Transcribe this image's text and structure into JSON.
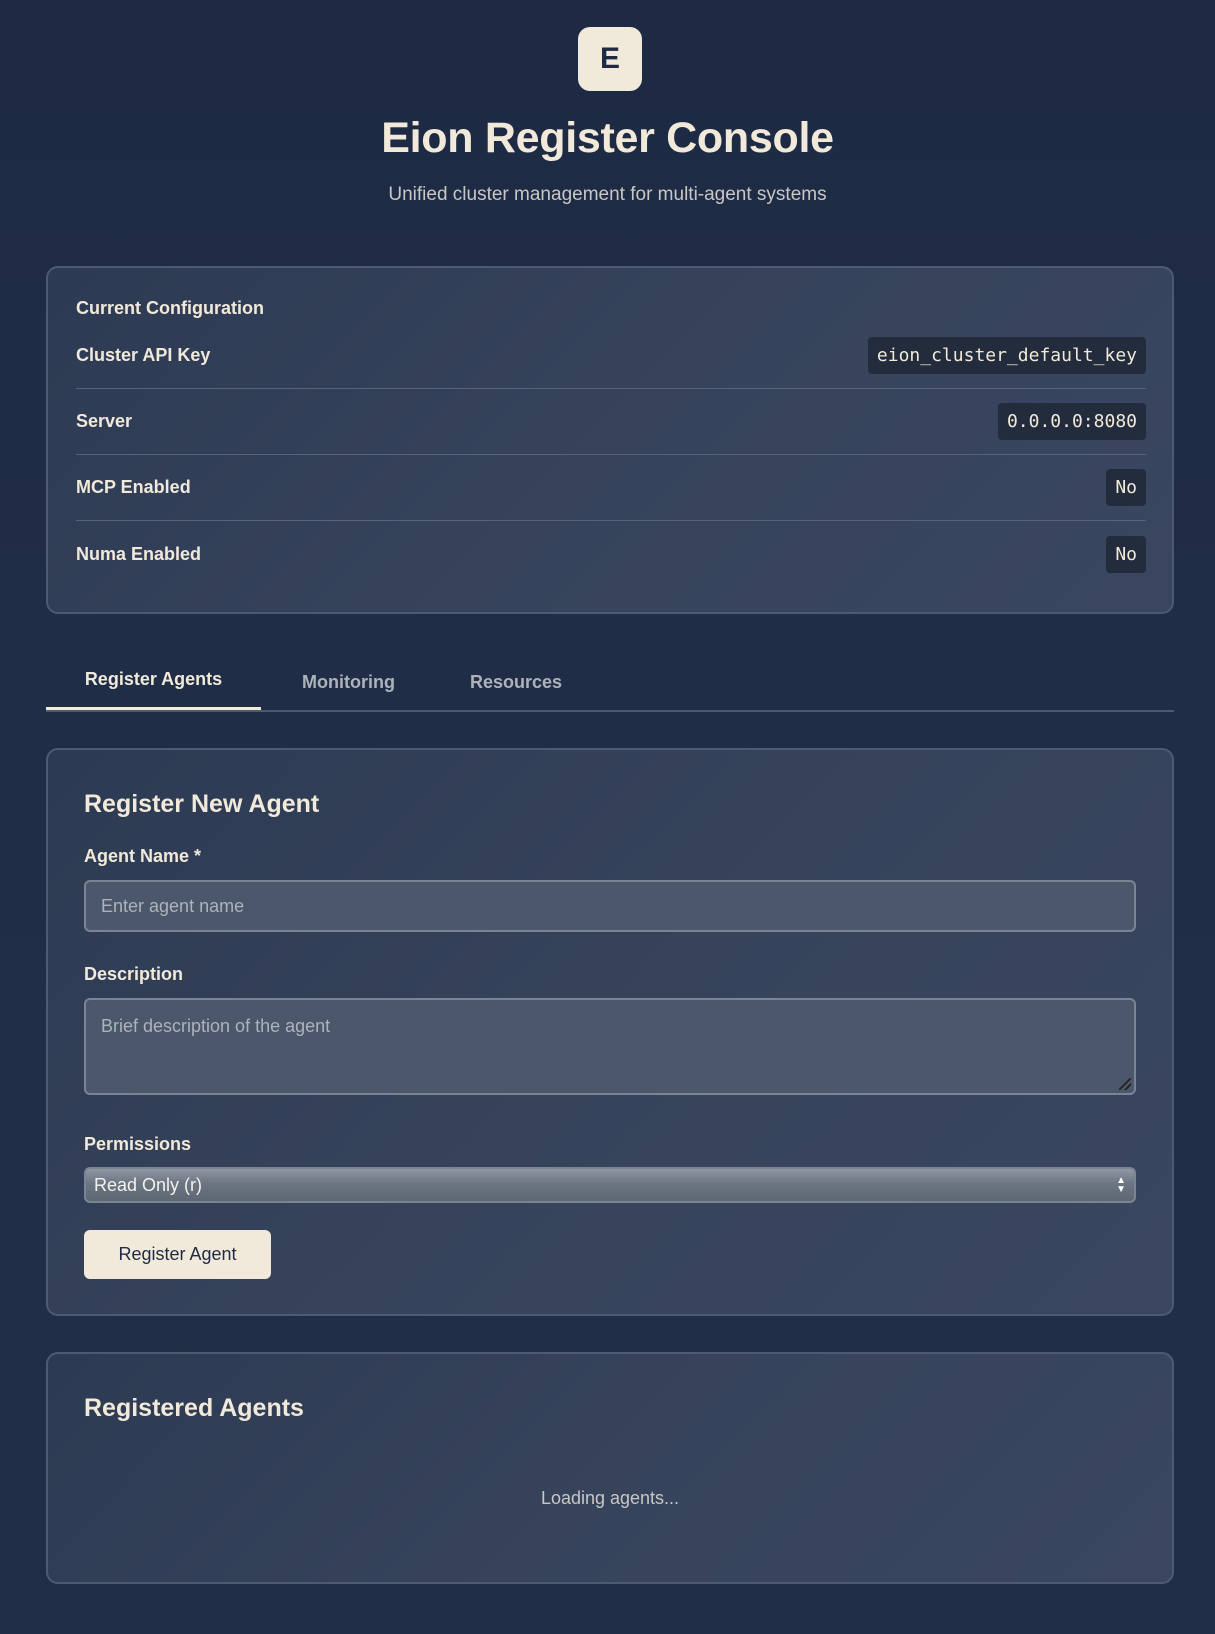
{
  "header": {
    "logo_letter": "E",
    "title": "Eion Register Console",
    "subtitle": "Unified cluster management for multi-agent systems"
  },
  "config": {
    "heading": "Current Configuration",
    "rows": [
      {
        "label": "Cluster API Key",
        "value": "eion_cluster_default_key"
      },
      {
        "label": "Server",
        "value": "0.0.0.0:8080"
      },
      {
        "label": "MCP Enabled",
        "value": "No"
      },
      {
        "label": "Numa Enabled",
        "value": "No"
      }
    ]
  },
  "tabs": [
    {
      "label": "Register Agents",
      "active": true
    },
    {
      "label": "Monitoring",
      "active": false
    },
    {
      "label": "Resources",
      "active": false
    }
  ],
  "register_form": {
    "title": "Register New Agent",
    "name_label": "Agent Name *",
    "name_placeholder": "Enter agent name",
    "description_label": "Description",
    "description_placeholder": "Brief description of the agent",
    "permissions_label": "Permissions",
    "permissions_selected": "Read Only (r)",
    "submit_label": "Register Agent"
  },
  "agents_panel": {
    "title": "Registered Agents",
    "loading_text": "Loading agents..."
  },
  "colors": {
    "background": "#1f2b44",
    "accent": "#f1e9d9",
    "card_border": "#4d5a70"
  }
}
